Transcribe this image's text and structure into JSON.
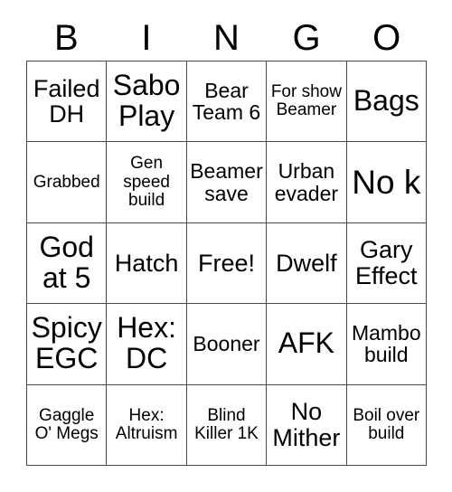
{
  "card": {
    "title": "BINGO Card",
    "headers": [
      "B",
      "I",
      "N",
      "G",
      "O"
    ],
    "colors": {
      "background": "#ffffff",
      "border": "#4a4a4a",
      "text": "#000000"
    },
    "grid_size": "5x5",
    "free_space": "Free!",
    "cells": [
      [
        {
          "text": "Failed DH",
          "size": "l"
        },
        {
          "text": "Sabo Play",
          "size": "xl"
        },
        {
          "text": "Bear Team 6",
          "size": "m"
        },
        {
          "text": "For show Beamer",
          "size": "s"
        },
        {
          "text": "Bags",
          "size": "xl"
        }
      ],
      [
        {
          "text": "Grabbed",
          "size": "s"
        },
        {
          "text": "Gen speed build",
          "size": "s"
        },
        {
          "text": "Beamer save",
          "size": "m"
        },
        {
          "text": "Urban evader",
          "size": "m"
        },
        {
          "text": "No k",
          "size": "xxl"
        }
      ],
      [
        {
          "text": "God at 5",
          "size": "xl"
        },
        {
          "text": "Hatch",
          "size": "l"
        },
        {
          "text": "Free!",
          "size": "l"
        },
        {
          "text": "Dwelf",
          "size": "l"
        },
        {
          "text": "Gary Effect",
          "size": "l"
        }
      ],
      [
        {
          "text": "Spicy EGC",
          "size": "xl"
        },
        {
          "text": "Hex: DC",
          "size": "xl"
        },
        {
          "text": "Booner",
          "size": "m"
        },
        {
          "text": "AFK",
          "size": "xl"
        },
        {
          "text": "Mambo build",
          "size": "m"
        }
      ],
      [
        {
          "text": "Gaggle O' Megs",
          "size": "s"
        },
        {
          "text": "Hex: Altruism",
          "size": "s"
        },
        {
          "text": "Blind Killer 1K",
          "size": "s"
        },
        {
          "text": "No Mither",
          "size": "l"
        },
        {
          "text": "Boil over build",
          "size": "s"
        }
      ]
    ]
  }
}
